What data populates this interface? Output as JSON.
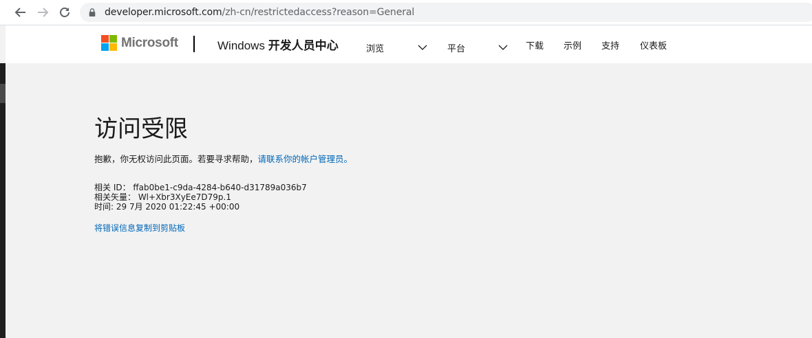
{
  "browser": {
    "url_host": "developer.microsoft.com",
    "url_path": "/zh-cn/restrictedaccess?reason=General"
  },
  "header": {
    "brand": "Microsoft",
    "site_title_latin": "Windows",
    "site_title_cjk": "开发人员中心",
    "nav": {
      "browse": "浏览",
      "platform": "平台",
      "downloads": "下载",
      "samples": "示例",
      "support": "支持",
      "dashboard": "仪表板"
    },
    "logo_colors": [
      "#f25022",
      "#7fba00",
      "#00a4ef",
      "#ffb900"
    ]
  },
  "content": {
    "title": "访问受限",
    "message": "抱歉，你无权访问此页面。若要寻求帮助，",
    "message_link": "请联系你的帐户管理员。",
    "correlation_id": "相关 ID： ffab0be1-c9da-4284-b640-d31789a036b7",
    "correlation_vector": "相关矢量： Wl+Xbr3XyEe7D79p.1",
    "time": "时间: 29 7月 2020 01:22:45 +00:00",
    "copy_link": "将错误信息复制到剪贴板"
  },
  "colors": {
    "link": "#0067b8",
    "page_bg": "#f2f2f2"
  }
}
